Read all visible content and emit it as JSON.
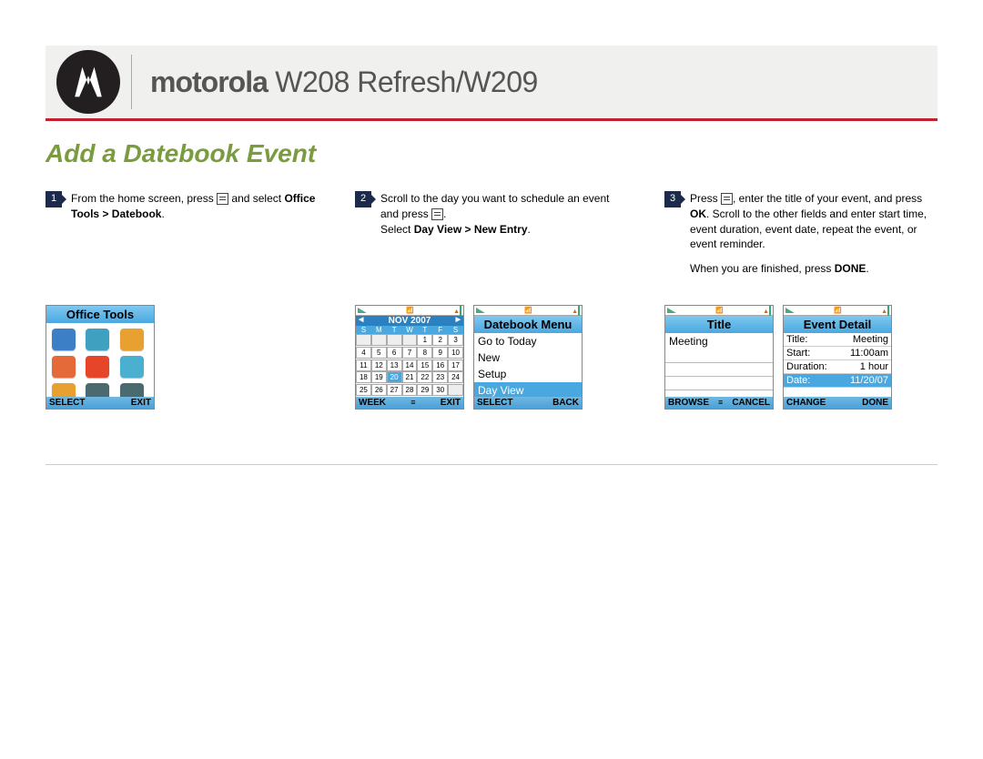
{
  "header": {
    "brand_bold": "motorola",
    "brand_rest": " W208 Refresh/W209"
  },
  "section_title": "Add a Datebook Event",
  "steps": {
    "s1": {
      "num": "1",
      "text_a": "From the home screen, press ",
      "text_b": " and select ",
      "bold": "Office Tools > Datebook",
      "tail": "."
    },
    "s2": {
      "num": "2",
      "text_a": "Scroll to the day you want to schedule an event and press ",
      "text_b": ".",
      "line2_a": "Select ",
      "line2_bold": "Day View > New Entry",
      "line2_b": "."
    },
    "s3": {
      "num": "3",
      "text_a": "Press ",
      "text_b": ", enter the title of your event, and press ",
      "bold1": "OK",
      "text_c": ". Scroll to the other fields and enter start time, event duration, event date, repeat the event, or event reminder.",
      "line2_a": "When you are finished, press ",
      "line2_bold": "DONE",
      "line2_b": "."
    }
  },
  "screens": {
    "office": {
      "title": "Office Tools",
      "left": "SELECT",
      "right": "EXIT",
      "icons": [
        "mail-icon",
        "board-icon",
        "notes-icon",
        "game-icon",
        "clock-icon",
        "wifi-icon",
        "tools-icon",
        "radio-icon",
        "pager-icon"
      ],
      "colors": [
        "#3d7fc7",
        "#3fa0c0",
        "#e8a030",
        "#e56a3a",
        "#e6452a",
        "#4ab0d0",
        "#e8a030",
        "#4a6a70",
        "#4a6a70"
      ]
    },
    "calendar": {
      "month": "NOV 2007",
      "days": [
        "S",
        "M",
        "T",
        "W",
        "T",
        "F",
        "S"
      ],
      "cells": [
        "",
        "",
        "",
        "",
        "1",
        "2",
        "3",
        "4",
        "5",
        "6",
        "7",
        "8",
        "9",
        "10",
        "11",
        "12",
        "13",
        "14",
        "15",
        "16",
        "17",
        "18",
        "19",
        "20",
        "21",
        "22",
        "23",
        "24",
        "25",
        "26",
        "27",
        "28",
        "29",
        "30",
        ""
      ],
      "hl": "20",
      "left": "WEEK",
      "right": "EXIT"
    },
    "dmenu": {
      "title": "Datebook Menu",
      "items": [
        "Go to Today",
        "New",
        "Setup",
        "Day View"
      ],
      "hl": 3,
      "left": "SELECT",
      "right": "BACK"
    },
    "titlescr": {
      "title": "Title",
      "value": "Meeting",
      "left": "BROWSE",
      "right": "CANCEL"
    },
    "detail": {
      "title": "Event Detail",
      "rows": [
        {
          "l": "Title:",
          "r": "Meeting"
        },
        {
          "l": "Start:",
          "r": "11:00am"
        },
        {
          "l": "Duration:",
          "r": "1 hour"
        },
        {
          "l": "Date:",
          "r": "11/20/07"
        }
      ],
      "hl": 3,
      "left": "CHANGE",
      "right": "DONE"
    }
  }
}
